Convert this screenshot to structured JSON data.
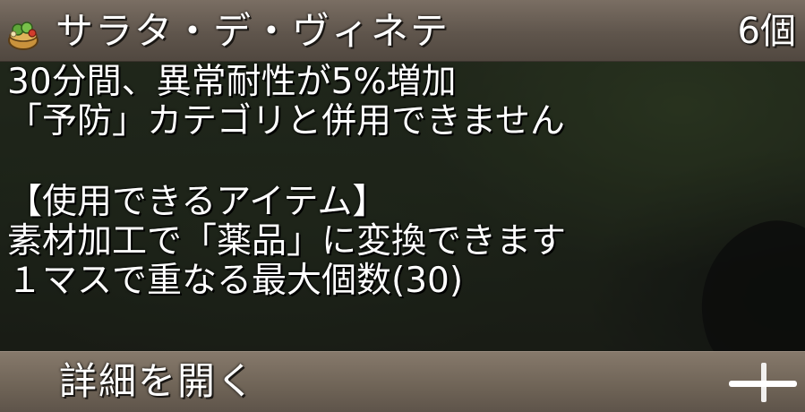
{
  "item": {
    "name": "サラタ・デ・ヴィネテ",
    "count": "6個",
    "icon": "salad-bowl-icon"
  },
  "description": {
    "lines": [
      "30分間、異常耐性が5%増加",
      "「予防」カテゴリと併用できません",
      "",
      "【使用できるアイテム】",
      "素材加工で「薬品」に変換できます",
      "１マスで重なる最大個数(30)"
    ]
  },
  "footer": {
    "label": "詳細を開く",
    "icon": "plus-icon"
  },
  "colors": {
    "title_bar": "#5f554c",
    "footer_bar": "#6e6356",
    "text": "#ffffff"
  }
}
